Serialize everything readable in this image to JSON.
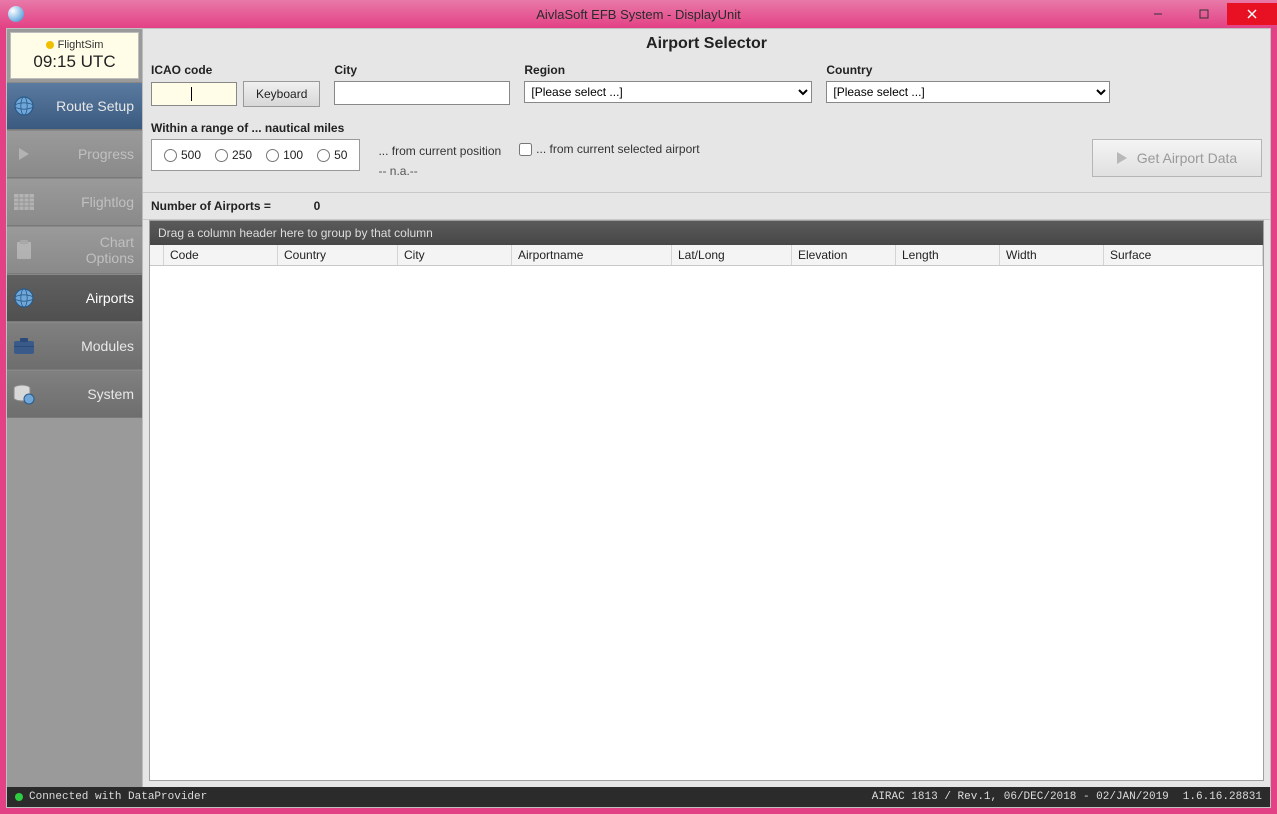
{
  "window": {
    "title": "AivlaSoft EFB System - DisplayUnit"
  },
  "sidebar": {
    "sim_label": "FlightSim",
    "clock": "09:15 UTC",
    "items": [
      {
        "label": "Route Setup"
      },
      {
        "label": "Progress"
      },
      {
        "label": "Flightlog"
      },
      {
        "label": "Chart Options"
      },
      {
        "label": "Airports"
      },
      {
        "label": "Modules"
      },
      {
        "label": "System"
      }
    ]
  },
  "page": {
    "title": "Airport Selector",
    "icao_label": "ICAO code",
    "city_label": "City",
    "region_label": "Region",
    "country_label": "Country",
    "keyboard_btn": "Keyboard",
    "select_placeholder": "[Please select ...]",
    "range_header": "Within a range of ... nautical miles",
    "range_options": [
      "500",
      "250",
      "100",
      "50"
    ],
    "from_current_pos": "... from current position",
    "na_text": "-- n.a.--",
    "from_selected_airport": "... from current selected airport",
    "get_data_btn": "Get Airport Data",
    "count_label": "Number of Airports =",
    "count_value": "0",
    "group_hint": "Drag a column header here to group by that column",
    "columns": [
      "Code",
      "Country",
      "City",
      "Airportname",
      "Lat/Long",
      "Elevation",
      "Length",
      "Width",
      "Surface"
    ]
  },
  "status": {
    "connected": "Connected with DataProvider",
    "airac": "AIRAC 1813 / Rev.1, 06/DEC/2018 - 02/JAN/2019",
    "version": "1.6.16.28831"
  }
}
